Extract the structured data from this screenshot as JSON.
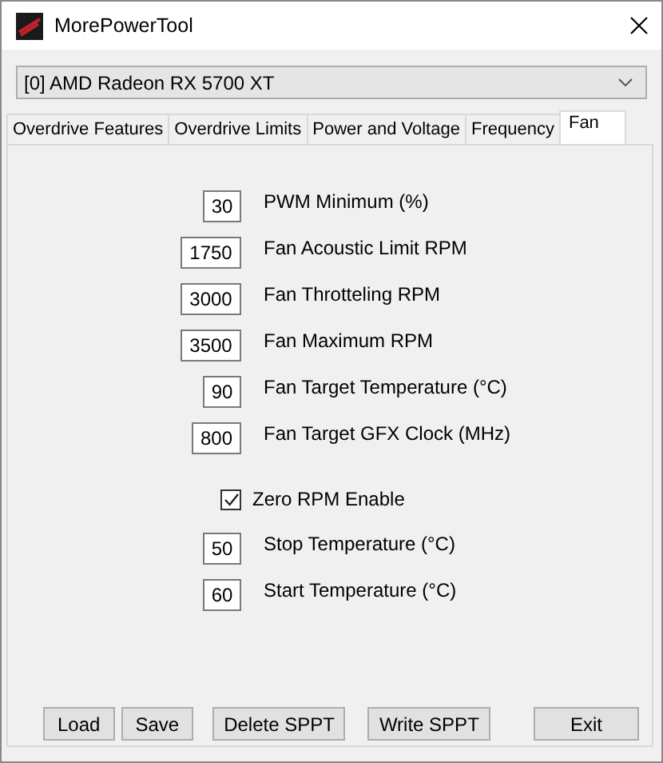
{
  "window": {
    "title": "MorePowerTool"
  },
  "device_select": {
    "value": "[0] AMD Radeon RX 5700 XT"
  },
  "tabs": [
    {
      "label": "Overdrive Features",
      "selected": false
    },
    {
      "label": "Overdrive Limits",
      "selected": false
    },
    {
      "label": "Power and Voltage",
      "selected": false
    },
    {
      "label": "Frequency",
      "selected": false
    },
    {
      "label": "Fan",
      "selected": true
    }
  ],
  "settings": [
    {
      "kind": "field",
      "value": "30",
      "label": "PWM Minimum (%)"
    },
    {
      "kind": "field",
      "value": "1750",
      "label": "Fan Acoustic Limit RPM"
    },
    {
      "kind": "field",
      "value": "3000",
      "label": "Fan Throtteling RPM"
    },
    {
      "kind": "field",
      "value": "3500",
      "label": "Fan Maximum RPM"
    },
    {
      "kind": "field",
      "value": "90",
      "label": "Fan Target Temperature (°C)"
    },
    {
      "kind": "field",
      "value": "800",
      "label": "Fan Target GFX Clock (MHz)"
    },
    {
      "kind": "checkbox",
      "label": "Zero RPM Enable",
      "checked": true
    },
    {
      "kind": "field",
      "value": "50",
      "label": "Stop Temperature (°C)"
    },
    {
      "kind": "field",
      "value": "60",
      "label": "Start Temperature (°C)"
    }
  ],
  "buttons": [
    "Load",
    "Save",
    "Delete SPPT",
    "Write SPPT",
    "Exit"
  ]
}
